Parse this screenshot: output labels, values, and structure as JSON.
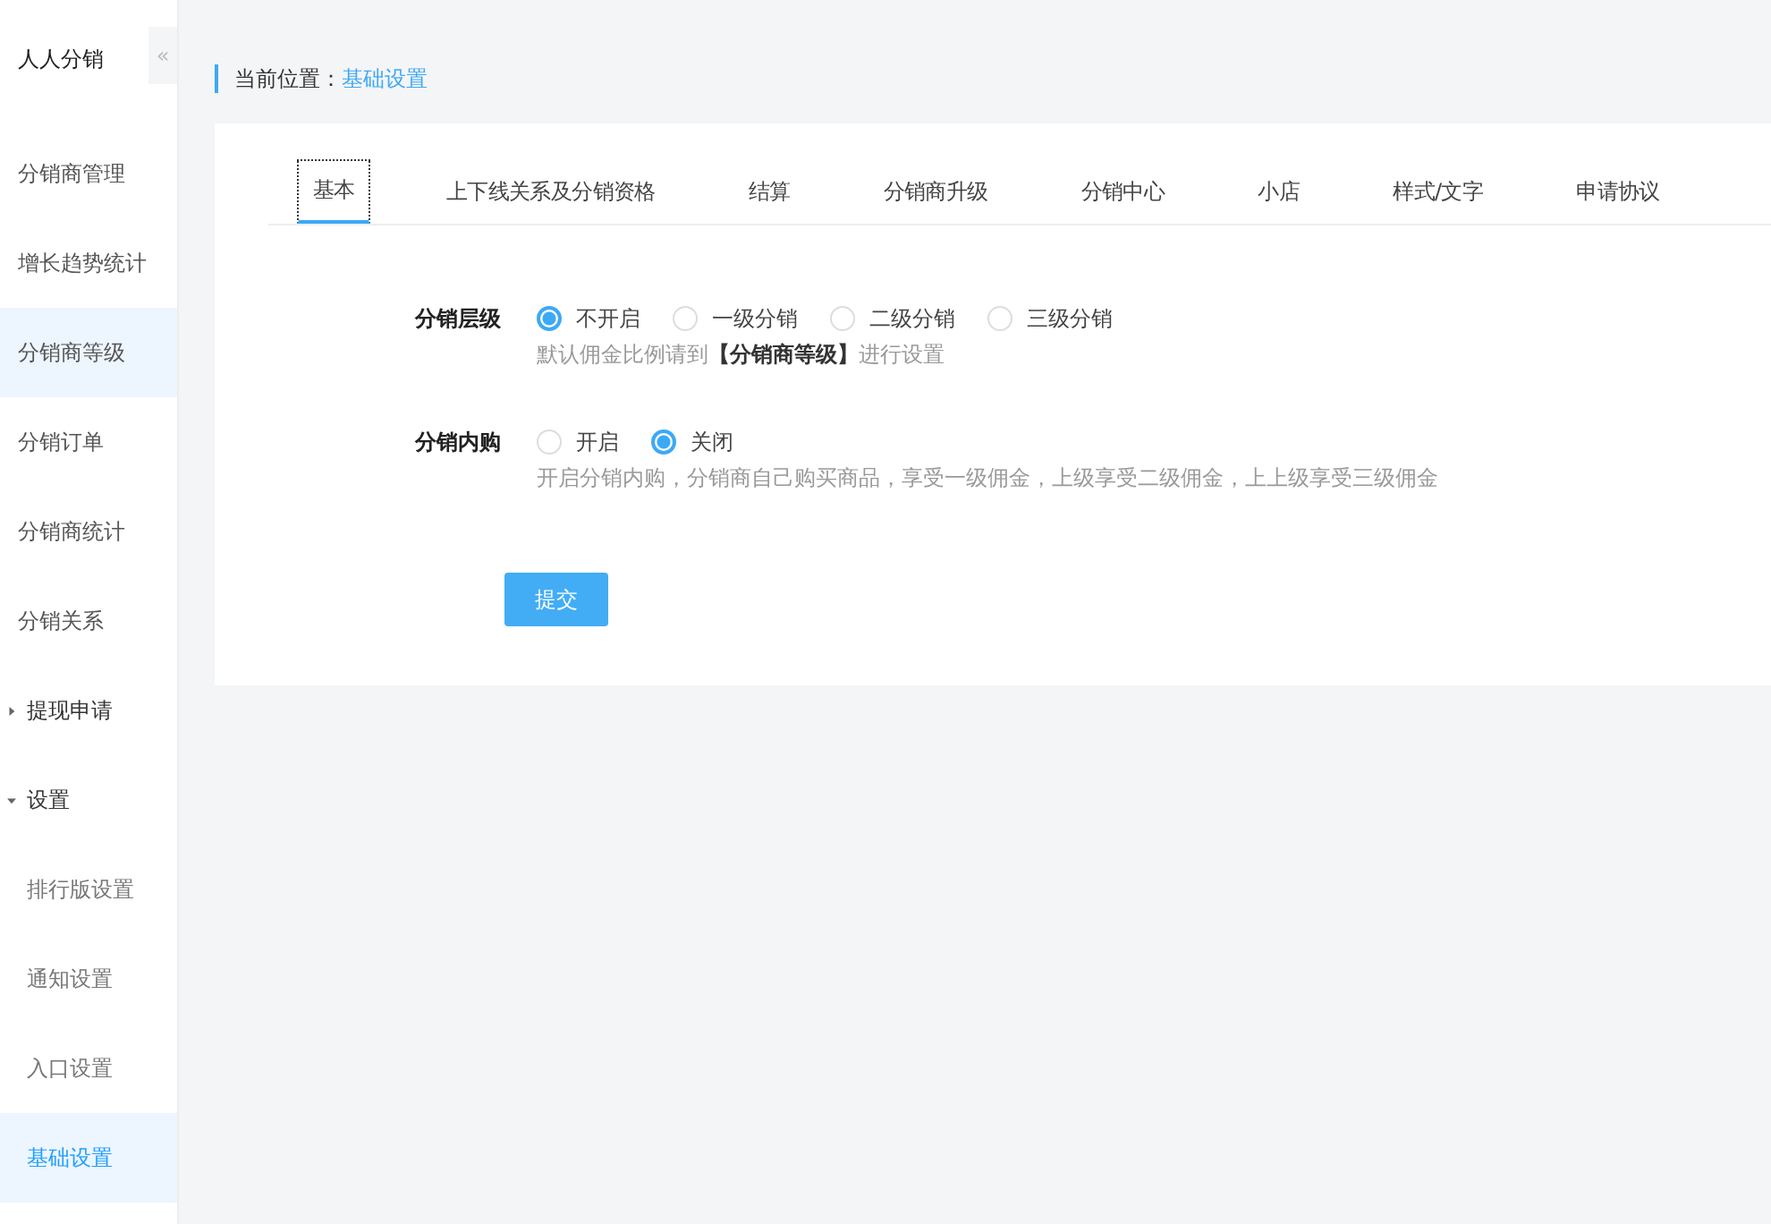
{
  "sidebar": {
    "title": "人人分销",
    "collapse_icon": "«",
    "items": [
      {
        "kind": "item",
        "label": "分销商管理",
        "selected": false,
        "hovered": false
      },
      {
        "kind": "item",
        "label": "增长趋势统计",
        "selected": false,
        "hovered": false
      },
      {
        "kind": "item",
        "label": "分销商等级",
        "selected": false,
        "hovered": true
      },
      {
        "kind": "item",
        "label": "分销订单",
        "selected": false,
        "hovered": false
      },
      {
        "kind": "item",
        "label": "分销商统计",
        "selected": false,
        "hovered": false
      },
      {
        "kind": "item",
        "label": "分销关系",
        "selected": false,
        "hovered": false
      },
      {
        "kind": "group",
        "label": "提现申请",
        "expanded": false
      },
      {
        "kind": "group",
        "label": "设置",
        "expanded": true,
        "children": [
          {
            "label": "排行版设置",
            "selected": false
          },
          {
            "label": "通知设置",
            "selected": false
          },
          {
            "label": "入口设置",
            "selected": false
          },
          {
            "label": "基础设置",
            "selected": true
          }
        ]
      }
    ]
  },
  "breadcrumb": {
    "label": "当前位置：",
    "current": "基础设置"
  },
  "tabs": [
    {
      "label": "基本",
      "selected": true
    },
    {
      "label": "上下线关系及分销资格",
      "selected": false
    },
    {
      "label": "结算",
      "selected": false
    },
    {
      "label": "分销商升级",
      "selected": false
    },
    {
      "label": "分销中心",
      "selected": false
    },
    {
      "label": "小店",
      "selected": false
    },
    {
      "label": "样式/文字",
      "selected": false
    },
    {
      "label": "申请协议",
      "selected": false
    }
  ],
  "form": [
    {
      "label": "分销层级",
      "options": [
        {
          "label": "不开启",
          "selected": true
        },
        {
          "label": "一级分销",
          "selected": false
        },
        {
          "label": "二级分销",
          "selected": false
        },
        {
          "label": "三级分销",
          "selected": false
        }
      ],
      "help": "默认佣金比例请到**【分销商等级】**进行设置"
    },
    {
      "label": "分销内购",
      "options": [
        {
          "label": "开启",
          "selected": false
        },
        {
          "label": "关闭",
          "selected": true
        }
      ],
      "help": "开启分销内购，分销商自己购买商品，享受一级佣金，上级享受二级佣金，上上级享受三级佣金"
    }
  ],
  "submit": "提交"
}
